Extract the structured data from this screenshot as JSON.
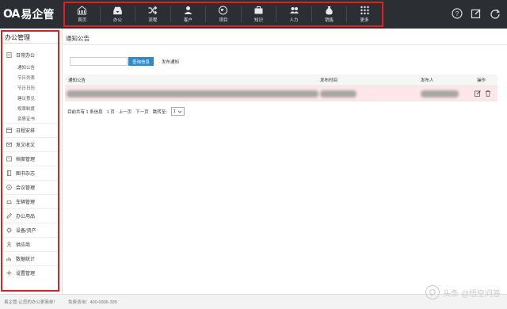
{
  "app": {
    "logo_mark": "OA",
    "logo_text": "易企管"
  },
  "topnav": [
    {
      "label": "首页",
      "icon": "home-icon"
    },
    {
      "label": "办公",
      "icon": "inbox-icon"
    },
    {
      "label": "流程",
      "icon": "shuffle-icon"
    },
    {
      "label": "客户",
      "icon": "user-icon"
    },
    {
      "label": "项目",
      "icon": "globe-icon"
    },
    {
      "label": "知识",
      "icon": "briefcase-icon"
    },
    {
      "label": "人力",
      "icon": "users-icon"
    },
    {
      "label": "销售",
      "icon": "money-bag-icon"
    },
    {
      "label": "更多",
      "icon": "grid-icon"
    }
  ],
  "top_icons": [
    "help-icon",
    "edit-icon",
    "refresh-icon"
  ],
  "sidebar": {
    "title": "办公管理",
    "group": {
      "label": "日常办公",
      "subitems": [
        "通知公告",
        "节日列表",
        "节日日历",
        "建议意见",
        "规章制度",
        "资质证书"
      ]
    },
    "items": [
      "日程安排",
      "发文收文",
      "档案管理",
      "图书杂志",
      "会议管理",
      "车辆管理",
      "办公用品",
      "设备/资产",
      "供应商",
      "数据统计",
      "设置管理"
    ]
  },
  "main": {
    "title": "通知公告",
    "search": {
      "value": ""
    },
    "query_button": "查询信息",
    "publish_button": "发布通知",
    "columns": [
      "通知公告",
      "发布时间",
      "发布人",
      "操作"
    ],
    "pager": {
      "summary": "目前共有 1 条信息",
      "page": "1 页",
      "prev": "上一页",
      "next": "下一页",
      "jump": "跳转至:",
      "selected": "1"
    }
  },
  "footer": {
    "text": "易企管-让您的办公更简单！",
    "phone": "免费咨询：400-0906-395"
  },
  "watermark": "头条 @悟空问答",
  "colors": {
    "topbar": "#2b2f33",
    "accent": "#2d8ac8",
    "highlight_frame": "#e02020",
    "row_highlight": "#fde7ea"
  }
}
